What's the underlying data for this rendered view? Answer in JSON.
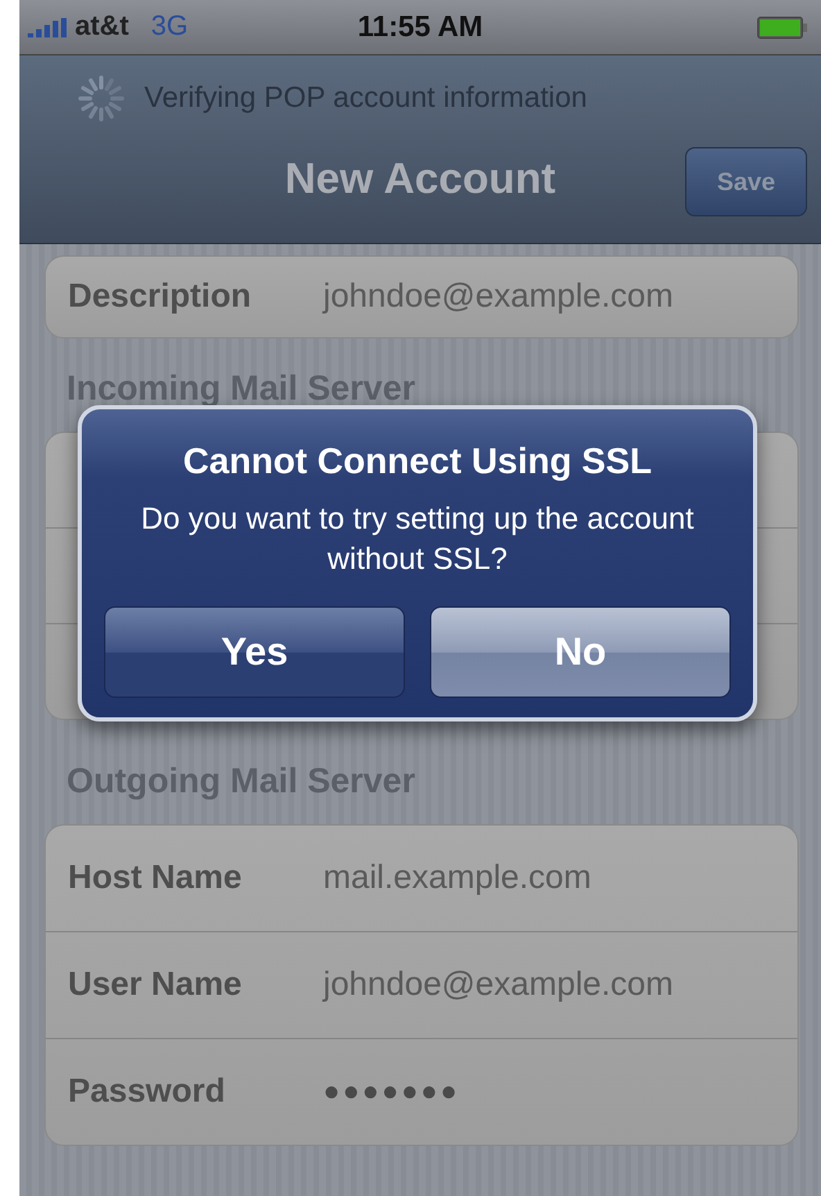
{
  "status_bar": {
    "carrier": "at&t",
    "network": "3G",
    "time": "11:55 AM"
  },
  "nav_bar": {
    "prompt": "Verifying POP account information",
    "title": "New Account",
    "save_button": {
      "label": "Save",
      "disabled": true
    }
  },
  "description_row": {
    "label": "Description",
    "value": "johndoe@example.com"
  },
  "incoming": {
    "header": "Incoming Mail Server"
  },
  "outgoing": {
    "header": "Outgoing Mail Server",
    "rows": [
      {
        "label": "Host Name",
        "value": "mail.example.com",
        "kind": "text"
      },
      {
        "label": "User Name",
        "value": "johndoe@example.com",
        "kind": "text"
      },
      {
        "label": "Password",
        "value": "●●●●●●●",
        "kind": "password"
      }
    ]
  },
  "alert": {
    "title": "Cannot Connect Using SSL",
    "message": "Do you want to try setting up the account without SSL?",
    "buttons": [
      {
        "label": "Yes",
        "selected": false
      },
      {
        "label": "No",
        "selected": true
      }
    ]
  }
}
